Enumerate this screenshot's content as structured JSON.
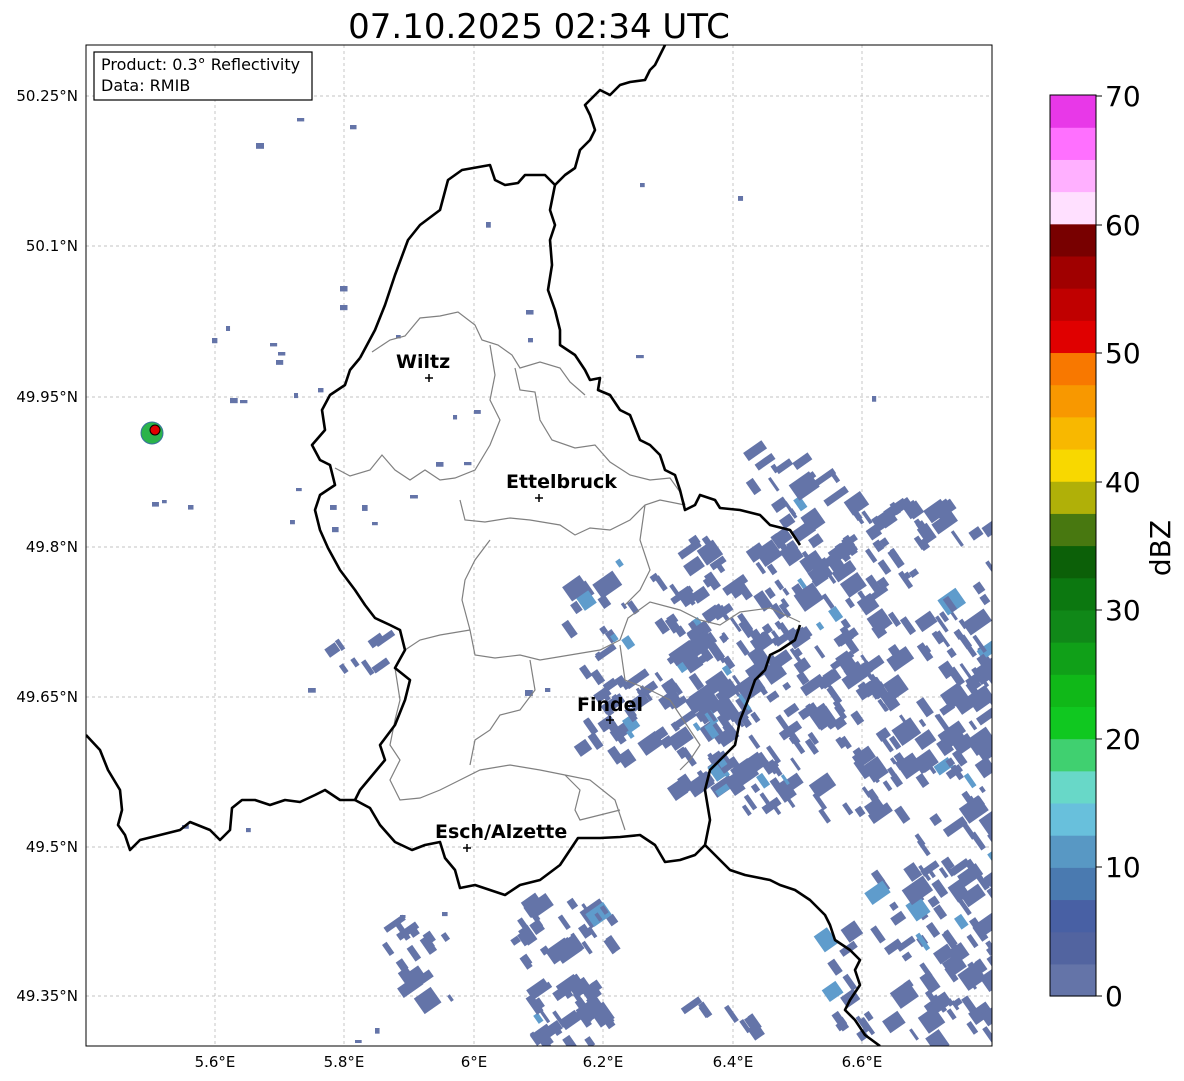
{
  "title": "07.10.2025 02:34 UTC",
  "info": {
    "product": "Product: 0.3° Reflectivity",
    "data": "Data: RMIB"
  },
  "axes": {
    "lon_ticks": [
      "5.6°E",
      "5.8°E",
      "6°E",
      "6.2°E",
      "6.4°E",
      "6.6°E"
    ],
    "lat_ticks": [
      "50.25°N",
      "50.1°N",
      "49.95°N",
      "49.8°N",
      "49.65°N",
      "49.5°N",
      "49.35°N"
    ]
  },
  "cities": [
    {
      "name": "Wiltz"
    },
    {
      "name": "Ettelbruck"
    },
    {
      "name": "Findel"
    },
    {
      "name": "Esch/Alzette"
    }
  ],
  "colorbar": {
    "label": "dBZ",
    "ticks": [
      "70",
      "60",
      "50",
      "40",
      "30",
      "20",
      "10",
      "0"
    ],
    "colors": [
      "#6474a8",
      "#5264a0",
      "#4860a4",
      "#4a7ab0",
      "#5898c4",
      "#68c0dc",
      "#68d8c8",
      "#40d070",
      "#10c820",
      "#10b818",
      "#10a018",
      "#108818",
      "#0c7810",
      "#0c6008",
      "#487810",
      "#b0b008",
      "#f8d800",
      "#f8b800",
      "#f89800",
      "#f87800",
      "#e00000",
      "#c00000",
      "#a00000",
      "#780000",
      "#ffe0ff",
      "#ffb0ff",
      "#ff70ff",
      "#e838e8"
    ],
    "min": 0,
    "max": 70,
    "step": 2.5
  },
  "colors": {
    "echo_main": "#6474a8",
    "echo_strong": "#5f9ccc",
    "border": "#000000",
    "canton": "#808080",
    "grid": "#b0b0b0",
    "radar_site": "#e00000"
  }
}
